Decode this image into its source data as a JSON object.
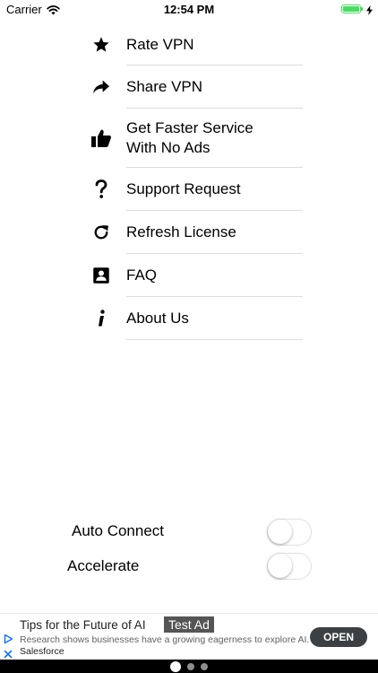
{
  "status_bar": {
    "carrier": "Carrier",
    "time": "12:54 PM",
    "battery_level": 1.0
  },
  "menu": [
    {
      "label": "Rate VPN",
      "icon": "star-icon"
    },
    {
      "label": "Share VPN",
      "icon": "share-arrow-icon"
    },
    {
      "label": "Get Faster Service\nWith No Ads",
      "icon": "thumbs-up-icon"
    },
    {
      "label": "Support Request",
      "icon": "question-mark-icon"
    },
    {
      "label": "Refresh License",
      "icon": "refresh-icon"
    },
    {
      "label": "FAQ",
      "icon": "contact-card-icon"
    },
    {
      "label": "About Us",
      "icon": "info-icon"
    }
  ],
  "toggles": {
    "auto_connect": {
      "label": "Auto Connect",
      "on": false
    },
    "accelerate": {
      "label": "Accelerate",
      "on": false
    }
  },
  "ad": {
    "title": "Tips for the Future of AI",
    "badge": "Test Ad",
    "description": "Research shows businesses have a growing eagerness to explore AI.",
    "advertiser": "Salesforce",
    "cta": "OPEN"
  },
  "pager": {
    "count": 3,
    "active": 0
  },
  "colors": {
    "battery": "#4cd964",
    "divider": "#dcdcdc",
    "cta_bg": "#3c4043",
    "ad_accent": "#1a73e8"
  }
}
